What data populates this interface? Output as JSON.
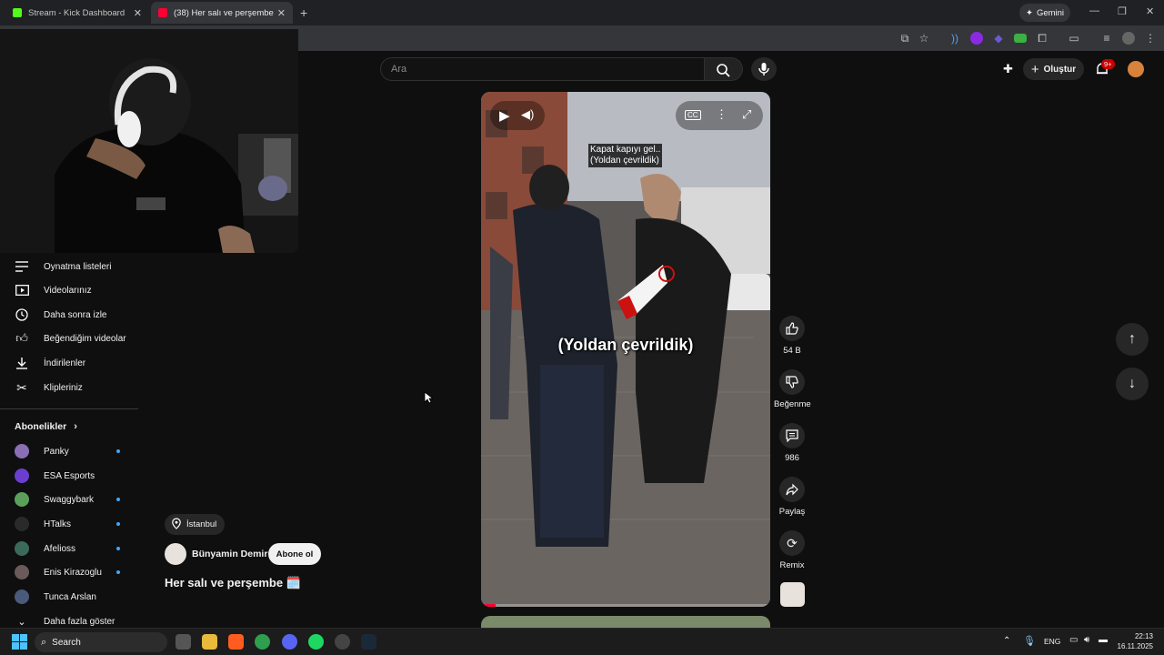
{
  "browser": {
    "tabs": [
      {
        "title": "Stream - Kick Dashboard",
        "favicon_color": "#53fc18"
      },
      {
        "title": "(38) Her salı ve perşembe 🗓️ -",
        "favicon_color": "#ff0033"
      }
    ],
    "gemini_label": "Gemini"
  },
  "header": {
    "search_placeholder": "Ara",
    "create_label": "Oluştur",
    "notification_count": "9+"
  },
  "sidebar": {
    "items": [
      {
        "label": "Oynatma listeleri",
        "icon": "playlist-icon"
      },
      {
        "label": "Videolarınız",
        "icon": "your-videos-icon"
      },
      {
        "label": "Daha sonra izle",
        "icon": "watch-later-icon"
      },
      {
        "label": "Beğendiğim videolar",
        "icon": "like-icon"
      },
      {
        "label": "İndirilenler",
        "icon": "download-icon"
      },
      {
        "label": "Klipleriniz",
        "icon": "clips-icon"
      }
    ],
    "subscriptions_title": "Abonelikler",
    "subscriptions": [
      {
        "name": "Panky",
        "color": "#8a6fb5",
        "new": true
      },
      {
        "name": "ESA Esports",
        "color": "#6a3fd0",
        "new": false
      },
      {
        "name": "Swaggybark",
        "color": "#5aa05a",
        "new": true
      },
      {
        "name": "HTalks",
        "color": "#2a2a2a",
        "new": true
      },
      {
        "name": "Afelioss",
        "color": "#3a6a5a",
        "new": true
      },
      {
        "name": "Enis Kirazoglu",
        "color": "#6a5a5a",
        "new": true
      },
      {
        "name": "Tunca Arslan",
        "color": "#4a5a7a",
        "new": false
      }
    ],
    "show_more": "Daha fazla göster"
  },
  "short": {
    "location": "İstanbul",
    "channel": "Bünyamin Demir",
    "subscribe_label": "Abone ol",
    "title": "Her salı ve perşembe 🗓️",
    "overlay_caption_top_line1": "Kapat kapıyı gel..",
    "overlay_caption_top_line2": "(Yoldan çevrildik)",
    "overlay_caption_main": "(Yoldan çevrildik)",
    "cc_label": "CC",
    "progress": 0.05
  },
  "actions": {
    "likes": "54 B",
    "dislike_label": "Beğenme",
    "comments": "986",
    "share_label": "Paylaş",
    "remix_label": "Remix"
  },
  "taskbar": {
    "search_label": "Search",
    "language": "ENG",
    "time": "22:13",
    "date": "16.11.2025"
  }
}
